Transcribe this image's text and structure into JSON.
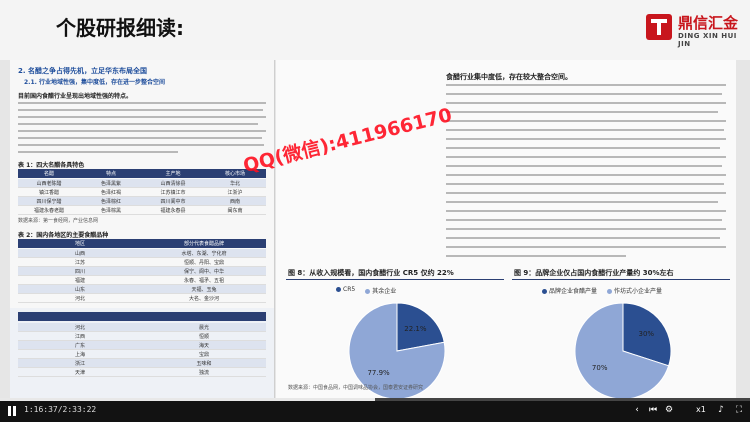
{
  "slide": {
    "title": "个股研报细读:",
    "logo": {
      "name": "鼎信汇金",
      "subtitle": "DING XIN HUI JIN"
    }
  },
  "left_page": {
    "section": "2.  名醋之争占得先机，立足华东布局全国",
    "subsection": "2.1.  行业地域性强，集中度低，存在进一步整合空间",
    "bold_para": "目前国内食醋行业呈现出地域性强的特点。",
    "table1": {
      "caption": "表 1：四大名醋各具特色",
      "headers": [
        "名醋",
        "特点",
        "主产地",
        "核心市场"
      ],
      "rows": [
        [
          "山西老陈醋",
          "色泽黑紫",
          "山西清徐县",
          "华北"
        ],
        [
          "镇江香醋",
          "色泽红褐",
          "江苏镇江市",
          "江浙沪"
        ],
        [
          "四川保宁醋",
          "色泽棕红",
          "四川阆中市",
          "西南"
        ],
        [
          "福建永春老醋",
          "色泽棕黑",
          "福建永春县",
          "闽东南"
        ]
      ],
      "source": "数据来源：第一食经网，产业信息网"
    },
    "table2": {
      "caption": "表 2：国内各地区的主要食醋品种",
      "headers": [
        "地区",
        "部分代表食醋品牌"
      ],
      "rows": [
        [
          "山西",
          "水塔、东湖、宁化府"
        ],
        [
          "江苏",
          "恒顺、丹阳、宝鼎"
        ],
        [
          "四川",
          "保宁、阆中、中华"
        ],
        [
          "福建",
          "永春、福矛、五祖"
        ],
        [
          "山东",
          "天福、玉兔"
        ],
        [
          "河北",
          "大名、金沙河"
        ]
      ]
    },
    "table3": {
      "rows": [
        [
          "河北",
          "晨光"
        ],
        [
          "江西",
          "恒顺"
        ],
        [
          "广东",
          "海天"
        ],
        [
          "上海",
          "宝鼎"
        ],
        [
          "浙江",
          "五味和"
        ],
        [
          "天津",
          "独流"
        ]
      ]
    }
  },
  "right_page": {
    "heading": "食醋行业集中度低，存在较大整合空间。",
    "figures": [
      {
        "title": "图 8：从收入规模看，国内食醋行业 CR5 仅约 22%",
        "legend": [
          "CR5",
          "其余企业"
        ],
        "slices": [
          {
            "label": "22.1%",
            "value": 22.1,
            "color": "#2b4f91"
          },
          {
            "label": "77.9%",
            "value": 77.9,
            "color": "#8fa7d6"
          }
        ]
      },
      {
        "title": "图 9：品牌企业仅占国内食醋行业产量约 30%左右",
        "legend": [
          "品牌企业食醋产量",
          "作坊式小企业产量"
        ],
        "slices": [
          {
            "label": "30%",
            "value": 30,
            "color": "#2b4f91"
          },
          {
            "label": "70%",
            "value": 70,
            "color": "#8fa7d6"
          }
        ]
      }
    ],
    "source": "数据来源：中国食品网，中国调味品协会，国泰君安证券研究"
  },
  "watermark": "QQ(微信):411966170",
  "player": {
    "time": "1:16:37/2:33:22",
    "progress": 0.5,
    "speed": "x1"
  }
}
